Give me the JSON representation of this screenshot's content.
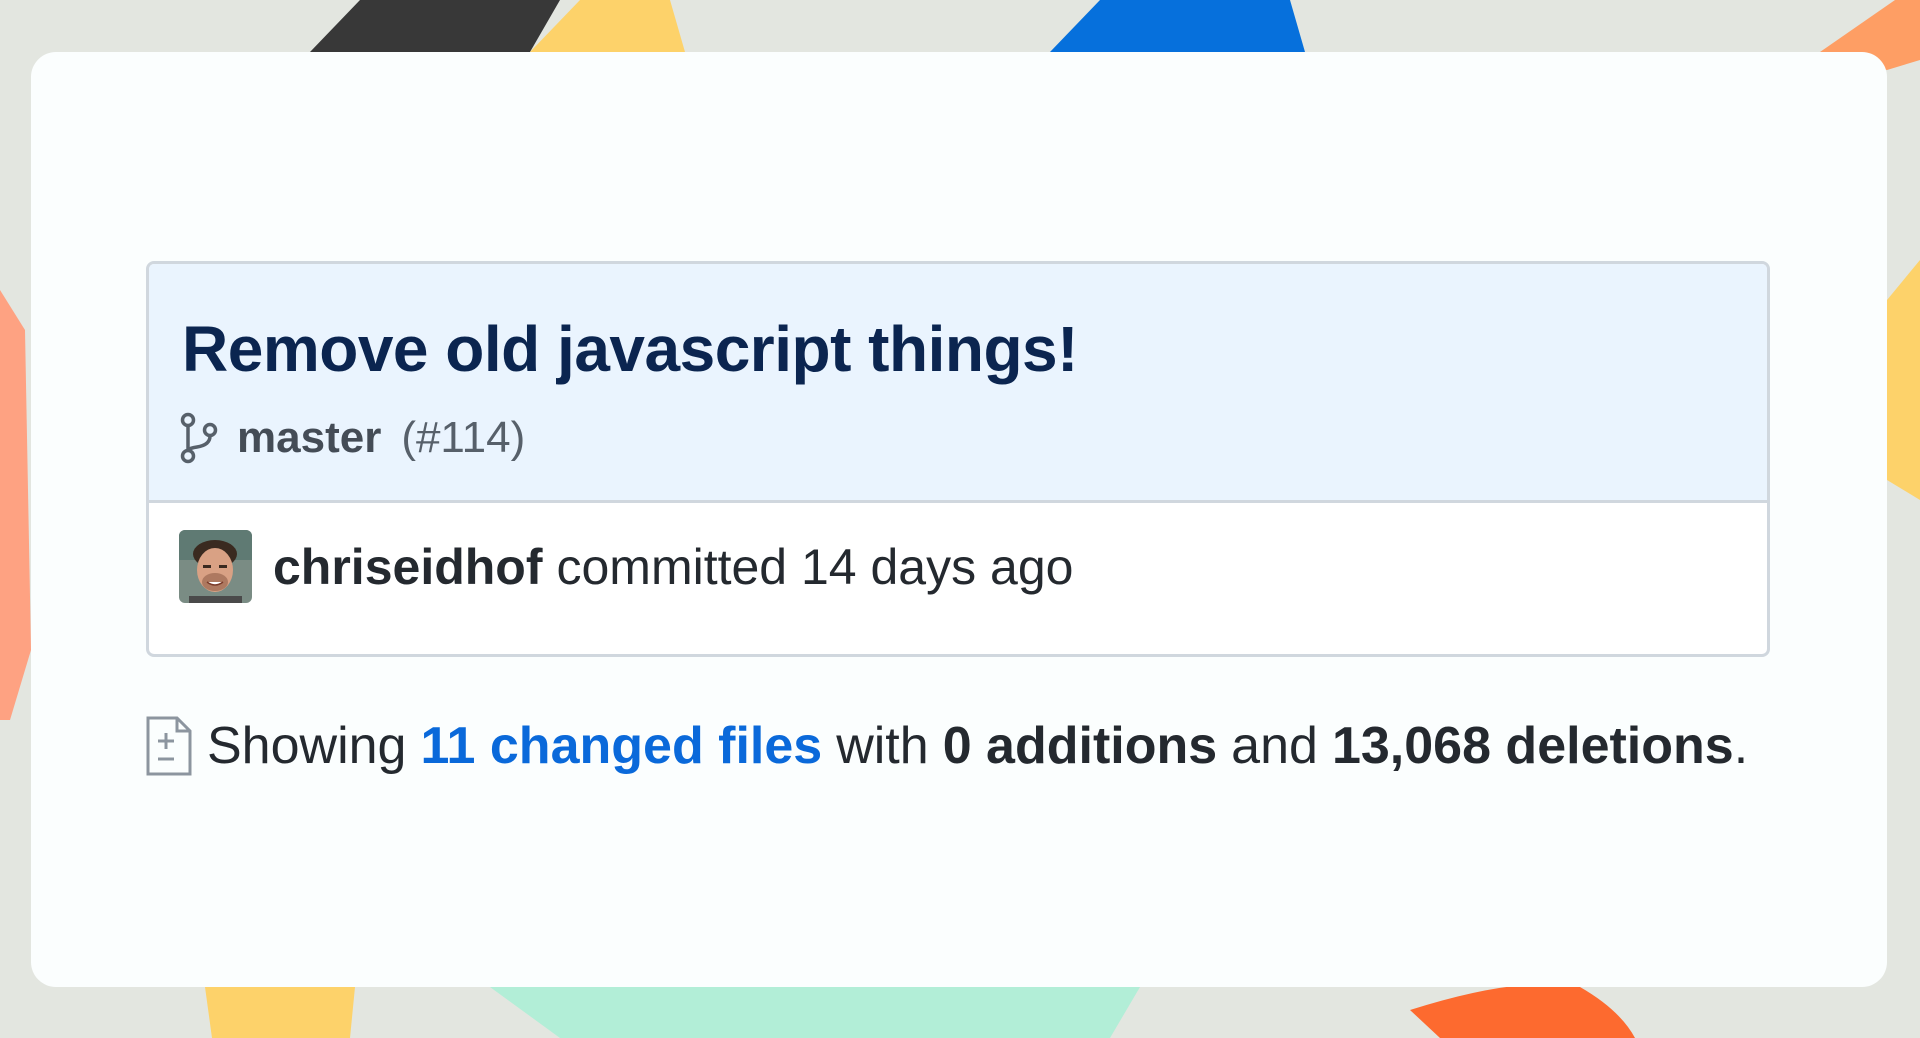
{
  "commit": {
    "title": "Remove old javascript things!",
    "branch": "master",
    "pr_number": "(#114)",
    "author": "chriseidhof",
    "committed_text": "committed 14 days ago"
  },
  "summary": {
    "showing": "Showing",
    "changed_files": "11 changed files",
    "with": "with",
    "additions": "0 additions",
    "and": "and",
    "deletions": "13,068 deletions",
    "period": "."
  },
  "colors": {
    "title": "#0b2550",
    "link": "#0a69da",
    "header_bg": "#eaf4fe",
    "border": "#d0d7de",
    "card_bg": "#fbfefe",
    "background": "#e3e6e0"
  },
  "icons": {
    "branch": "git-branch-icon",
    "file_diff": "file-diff-icon",
    "avatar": "avatar"
  }
}
